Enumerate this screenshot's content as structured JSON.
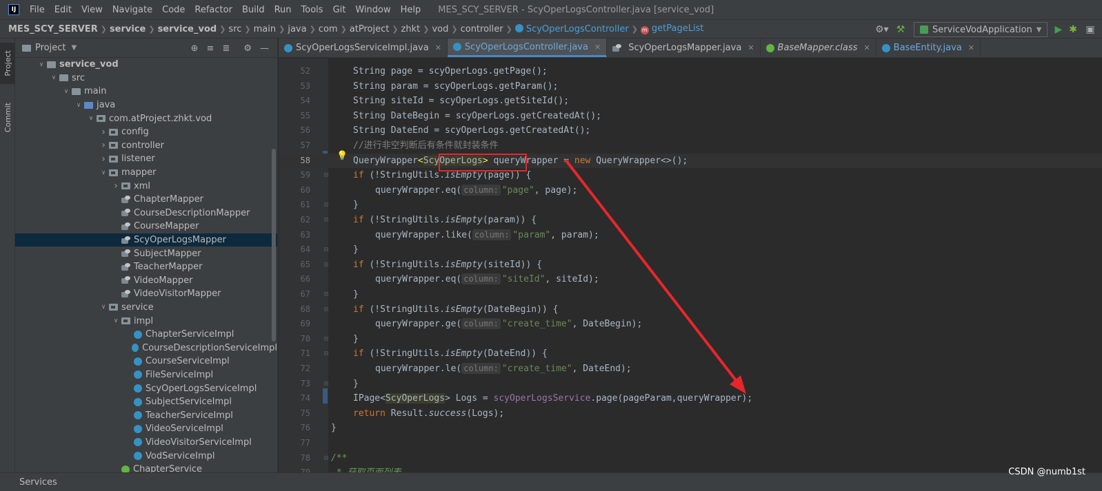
{
  "menubar": {
    "logo": "IJ",
    "items": [
      "File",
      "Edit",
      "View",
      "Navigate",
      "Code",
      "Refactor",
      "Build",
      "Run",
      "Tools",
      "Git",
      "Window",
      "Help"
    ],
    "title": "MES_SCY_SERVER - ScyOperLogsController.java [service_vod]"
  },
  "navbar": {
    "crumbs": [
      "MES_SCY_SERVER",
      "service",
      "service_vod",
      "src",
      "main",
      "java",
      "com",
      "atProject",
      "zhkt",
      "vod",
      "controller",
      "ScyOperLogsController",
      "getPageList"
    ],
    "run_config": "ServiceVodApplication"
  },
  "left_strip": {
    "project_tab": "Project",
    "commit_tab": "Commit"
  },
  "project_panel": {
    "title": "Project"
  },
  "tree": [
    {
      "label": "service_vod",
      "depth": 2,
      "chev": "v",
      "icon": "folder",
      "bold": true
    },
    {
      "label": "src",
      "depth": 3,
      "chev": "v",
      "icon": "folder"
    },
    {
      "label": "main",
      "depth": 4,
      "chev": "v",
      "icon": "folder"
    },
    {
      "label": "java",
      "depth": 5,
      "chev": "v",
      "icon": "java"
    },
    {
      "label": "com.atProject.zhkt.vod",
      "depth": 6,
      "chev": "v",
      "icon": "pkg"
    },
    {
      "label": "config",
      "depth": 7,
      "chev": ">",
      "icon": "pkg"
    },
    {
      "label": "controller",
      "depth": 7,
      "chev": ">",
      "icon": "pkg"
    },
    {
      "label": "listener",
      "depth": 7,
      "chev": ">",
      "icon": "pkg"
    },
    {
      "label": "mapper",
      "depth": 7,
      "chev": "v",
      "icon": "pkg"
    },
    {
      "label": "xml",
      "depth": 8,
      "chev": ">",
      "icon": "pkg"
    },
    {
      "label": "ChapterMapper",
      "depth": 8,
      "chev": "",
      "icon": "iface"
    },
    {
      "label": "CourseDescriptionMapper",
      "depth": 8,
      "chev": "",
      "icon": "iface"
    },
    {
      "label": "CourseMapper",
      "depth": 8,
      "chev": "",
      "icon": "iface"
    },
    {
      "label": "ScyOperLogsMapper",
      "depth": 8,
      "chev": "",
      "icon": "iface",
      "selected": true
    },
    {
      "label": "SubjectMapper",
      "depth": 8,
      "chev": "",
      "icon": "iface"
    },
    {
      "label": "TeacherMapper",
      "depth": 8,
      "chev": "",
      "icon": "iface"
    },
    {
      "label": "VideoMapper",
      "depth": 8,
      "chev": "",
      "icon": "iface"
    },
    {
      "label": "VideoVisitorMapper",
      "depth": 8,
      "chev": "",
      "icon": "iface"
    },
    {
      "label": "service",
      "depth": 7,
      "chev": "v",
      "icon": "pkg"
    },
    {
      "label": "impl",
      "depth": 8,
      "chev": "v",
      "icon": "pkg"
    },
    {
      "label": "ChapterServiceImpl",
      "depth": 9,
      "chev": "",
      "icon": "class"
    },
    {
      "label": "CourseDescriptionServiceImpl",
      "depth": 9,
      "chev": "",
      "icon": "class"
    },
    {
      "label": "CourseServiceImpl",
      "depth": 9,
      "chev": "",
      "icon": "class"
    },
    {
      "label": "FileServiceImpl",
      "depth": 9,
      "chev": "",
      "icon": "class"
    },
    {
      "label": "ScyOperLogsServiceImpl",
      "depth": 9,
      "chev": "",
      "icon": "class"
    },
    {
      "label": "SubjectServiceImpl",
      "depth": 9,
      "chev": "",
      "icon": "class"
    },
    {
      "label": "TeacherServiceImpl",
      "depth": 9,
      "chev": "",
      "icon": "class"
    },
    {
      "label": "VideoServiceImpl",
      "depth": 9,
      "chev": "",
      "icon": "class"
    },
    {
      "label": "VideoVisitorServiceImpl",
      "depth": 9,
      "chev": "",
      "icon": "class"
    },
    {
      "label": "VodServiceImpl",
      "depth": 9,
      "chev": "",
      "icon": "class"
    },
    {
      "label": "ChapterService",
      "depth": 8,
      "chev": "",
      "icon": "iface-green"
    }
  ],
  "tabs": [
    {
      "label": "ScyOperLogsServiceImpl.java",
      "icon": "class",
      "active": false,
      "italic": false
    },
    {
      "label": "ScyOperLogsController.java",
      "icon": "class",
      "active": true,
      "italic": false
    },
    {
      "label": "ScyOperLogsMapper.java",
      "icon": "iface",
      "active": false,
      "italic": false
    },
    {
      "label": "BaseMapper.class",
      "icon": "green",
      "active": false,
      "italic": true
    },
    {
      "label": "BaseEntity.java",
      "icon": "class",
      "active": false,
      "italic": false,
      "blue": true
    }
  ],
  "code_lines": [
    {
      "n": "52",
      "html": "String page = scyOperLogs.getPage();",
      "indent": 2
    },
    {
      "n": "53",
      "html": "String param = scyOperLogs.getParam();",
      "indent": 2
    },
    {
      "n": "54",
      "html": "String siteId = scyOperLogs.getSiteId();",
      "indent": 2
    },
    {
      "n": "55",
      "html": "String DateBegin = scyOperLogs.getCreatedAt();",
      "indent": 2
    },
    {
      "n": "56",
      "html": "String DateEnd = scyOperLogs.getCreatedAt();",
      "indent": 2
    },
    {
      "n": "57",
      "html": "//进行非空判断后有条件就封装条件",
      "indent": 2,
      "type": "comment"
    },
    {
      "n": "58",
      "indent": 2,
      "type": "qw"
    },
    {
      "n": "59",
      "indent": 2,
      "type": "if",
      "arg": "page"
    },
    {
      "n": "60",
      "indent": 3,
      "type": "call",
      "method": "eq",
      "col": "\"page\"",
      "val": "page"
    },
    {
      "n": "61",
      "indent": 2,
      "type": "close"
    },
    {
      "n": "62",
      "indent": 2,
      "type": "if",
      "arg": "param"
    },
    {
      "n": "63",
      "indent": 3,
      "type": "call",
      "method": "like",
      "col": "\"param\"",
      "val": "param"
    },
    {
      "n": "64",
      "indent": 2,
      "type": "close"
    },
    {
      "n": "65",
      "indent": 2,
      "type": "if",
      "arg": "siteId"
    },
    {
      "n": "66",
      "indent": 3,
      "type": "call",
      "method": "eq",
      "col": "\"siteId\"",
      "val": "siteId"
    },
    {
      "n": "67",
      "indent": 2,
      "type": "close"
    },
    {
      "n": "68",
      "indent": 2,
      "type": "if",
      "arg": "DateBegin"
    },
    {
      "n": "69",
      "indent": 3,
      "type": "call",
      "method": "ge",
      "col": "\"create_time\"",
      "val": "DateBegin"
    },
    {
      "n": "70",
      "indent": 2,
      "type": "close"
    },
    {
      "n": "71",
      "indent": 2,
      "type": "if",
      "arg": "DateEnd"
    },
    {
      "n": "72",
      "indent": 3,
      "type": "call",
      "method": "le",
      "col": "\"create_time\"",
      "val": "DateEnd"
    },
    {
      "n": "73",
      "indent": 2,
      "type": "close"
    },
    {
      "n": "74",
      "indent": 2,
      "type": "ipage"
    },
    {
      "n": "75",
      "indent": 2,
      "type": "return"
    },
    {
      "n": "76",
      "indent": 1,
      "type": "close"
    },
    {
      "n": "77",
      "indent": 0,
      "type": "blank"
    },
    {
      "n": "78",
      "indent": 1,
      "type": "doc_open"
    },
    {
      "n": "79",
      "indent": 1,
      "type": "doc_line",
      "text": " * 获取页面列表"
    }
  ],
  "code_tokens": {
    "string_type": "String",
    "query_wrapper": "QueryWrapper",
    "scy_oper_logs": "ScyOperLogs",
    "var_query_wrapper": "queryWrapper",
    "kw_new": "new",
    "kw_if": "if",
    "kw_return": "return",
    "string_utils": "StringUtils",
    "is_empty": "isEmpty",
    "hint_column": "column:",
    "ipage": "IPage",
    "logs": "Logs",
    "service_field": "scyOperLogsService",
    "page_call": "page(pageParam,queryWrapper);",
    "result": "Result",
    "success": "success"
  },
  "bottom": {
    "services": "Services",
    "watermark": "CSDN @numb1st"
  },
  "colors": {
    "annotation_red": "#e8262a",
    "accent_blue": "#4a88c7"
  }
}
